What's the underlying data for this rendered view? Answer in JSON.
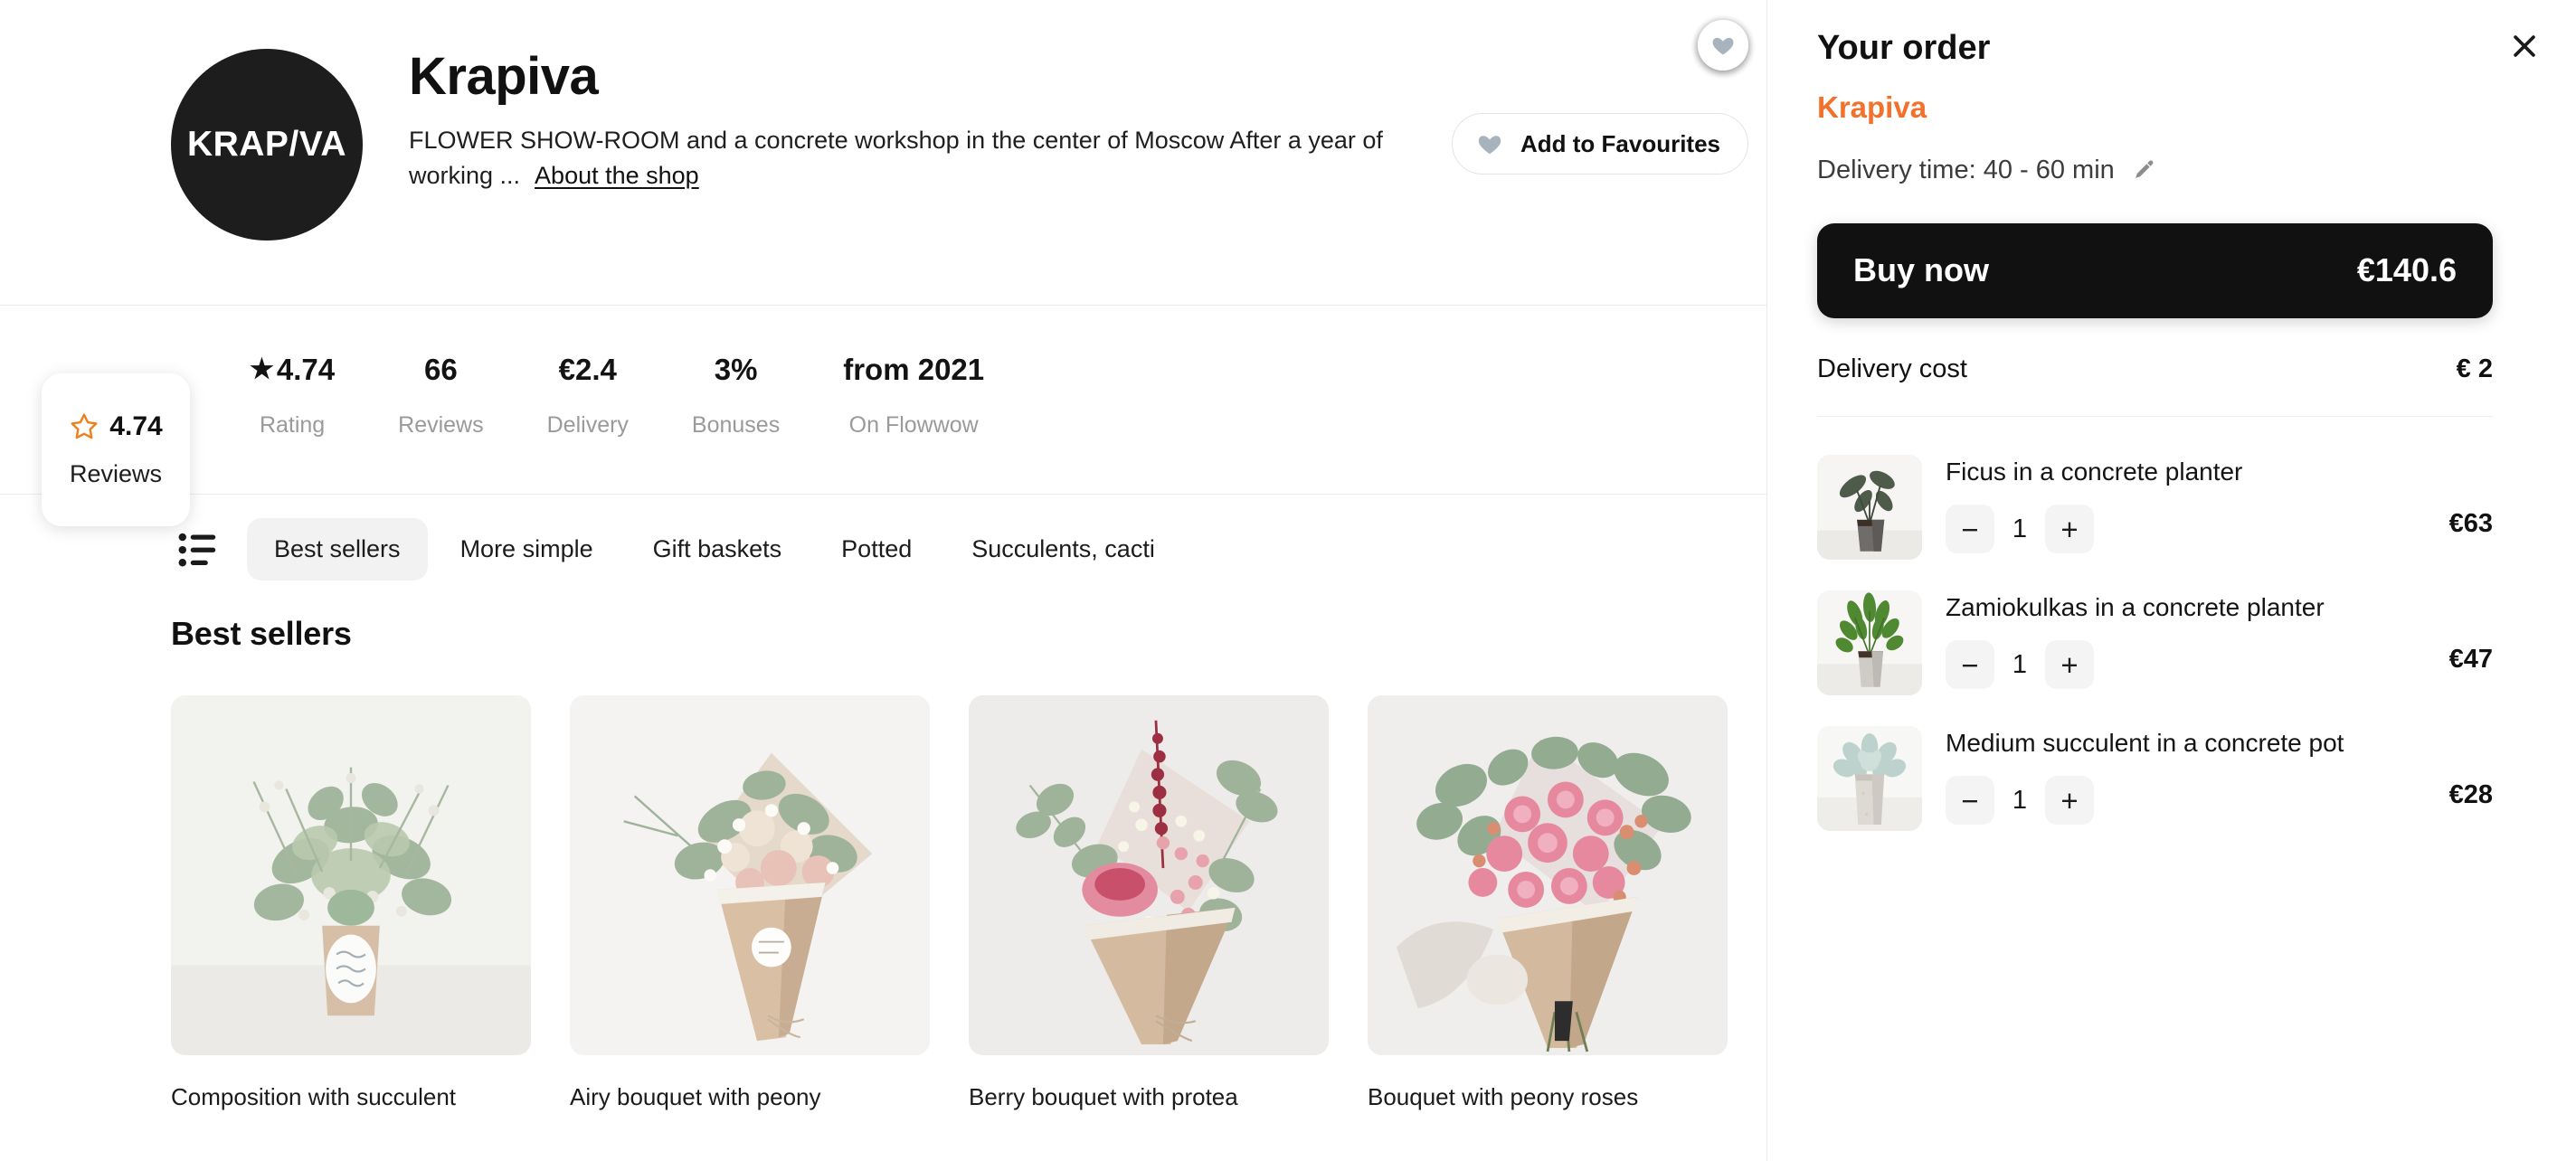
{
  "shop": {
    "logo_text": "KRAP/VA",
    "name": "Krapiva",
    "description": "FLOWER SHOW-ROOM and a concrete workshop in the center of Moscow After a year of working ...",
    "about_link": "About the shop",
    "favourites_button": "Add to Favourites"
  },
  "reviews_badge": {
    "score": "4.74",
    "caption": "Reviews"
  },
  "stats": [
    {
      "value": "4.74",
      "caption": "Rating",
      "has_star": true
    },
    {
      "value": "66",
      "caption": "Reviews",
      "has_star": false
    },
    {
      "value": "€2.4",
      "caption": "Delivery",
      "has_star": false
    },
    {
      "value": "3%",
      "caption": "Bonuses",
      "has_star": false
    },
    {
      "value": "from 2021",
      "caption": "On Flowwow",
      "has_star": false
    }
  ],
  "categories": [
    {
      "label": "Best sellers",
      "active": true
    },
    {
      "label": "More simple",
      "active": false
    },
    {
      "label": "Gift baskets",
      "active": false
    },
    {
      "label": "Potted",
      "active": false
    },
    {
      "label": "Succulents, cacti",
      "active": false
    }
  ],
  "section": {
    "title": "Best sellers"
  },
  "products": [
    {
      "title": "Composition with succulent"
    },
    {
      "title": "Airy bouquet with peony"
    },
    {
      "title": "Berry bouquet with protea"
    },
    {
      "title": "Bouquet with peony roses"
    }
  ],
  "order": {
    "title": "Your order",
    "shop_name": "Krapiva",
    "delivery_time": "Delivery time: 40 - 60 min",
    "buy_now_label": "Buy now",
    "buy_now_total": "€140.6",
    "delivery_cost_label": "Delivery cost",
    "delivery_cost_value": "€ 2",
    "items": [
      {
        "name": "Ficus in a concrete planter",
        "qty": "1",
        "price": "€63",
        "minus": "−",
        "plus": "+"
      },
      {
        "name": "Zamiokulkas in a concrete planter",
        "qty": "1",
        "price": "€47",
        "minus": "−",
        "plus": "+"
      },
      {
        "name": "Medium succulent in a concrete pot",
        "qty": "1",
        "price": "€28",
        "minus": "−",
        "plus": "+"
      }
    ]
  },
  "colors": {
    "accent_orange": "#f2722b",
    "heart_grey": "#a8b4bd",
    "dark_button": "#111111",
    "star_orange": "#ef7f1a"
  }
}
